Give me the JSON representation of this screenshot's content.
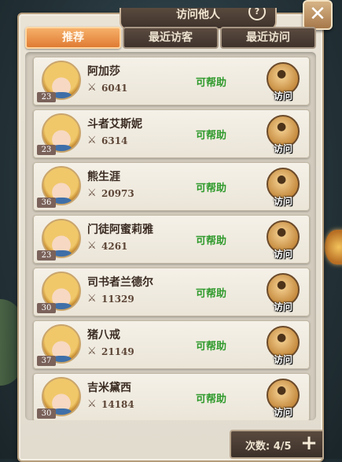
{
  "header": {
    "title": "访问他人",
    "info_icon": "info-icon",
    "close_icon": "close-icon"
  },
  "tabs": [
    {
      "label": "推荐",
      "active": true
    },
    {
      "label": "最近访客",
      "active": false
    },
    {
      "label": "最近访问",
      "active": false
    }
  ],
  "rows": [
    {
      "name": "阿加莎",
      "level": "23",
      "power": "6041",
      "status": "可帮助",
      "action": "访问"
    },
    {
      "name": "斗者艾斯妮",
      "level": "23",
      "power": "6314",
      "status": "可帮助",
      "action": "访问"
    },
    {
      "name": "熊生涯",
      "level": "36",
      "power": "20973",
      "status": "可帮助",
      "action": "访问"
    },
    {
      "name": "门徒阿蜜莉雅",
      "level": "23",
      "power": "4261",
      "status": "可帮助",
      "action": "访问"
    },
    {
      "name": "司书者兰德尔",
      "level": "30",
      "power": "11329",
      "status": "可帮助",
      "action": "访问"
    },
    {
      "name": "猪八戒",
      "level": "37",
      "power": "21149",
      "status": "可帮助",
      "action": "访问"
    },
    {
      "name": "吉米黛西",
      "level": "30",
      "power": "14184",
      "status": "可帮助",
      "action": "访问"
    }
  ],
  "footer": {
    "count_text": "次数: 4/5",
    "plus_label": "+"
  },
  "colors": {
    "accent": "#e07b33",
    "help_green": "#2f9a2c",
    "panel_bg": "#e9e3d6"
  },
  "icons": {
    "power": "crossed-swords-icon",
    "visit": "footprint-icon",
    "add": "plus-icon"
  }
}
